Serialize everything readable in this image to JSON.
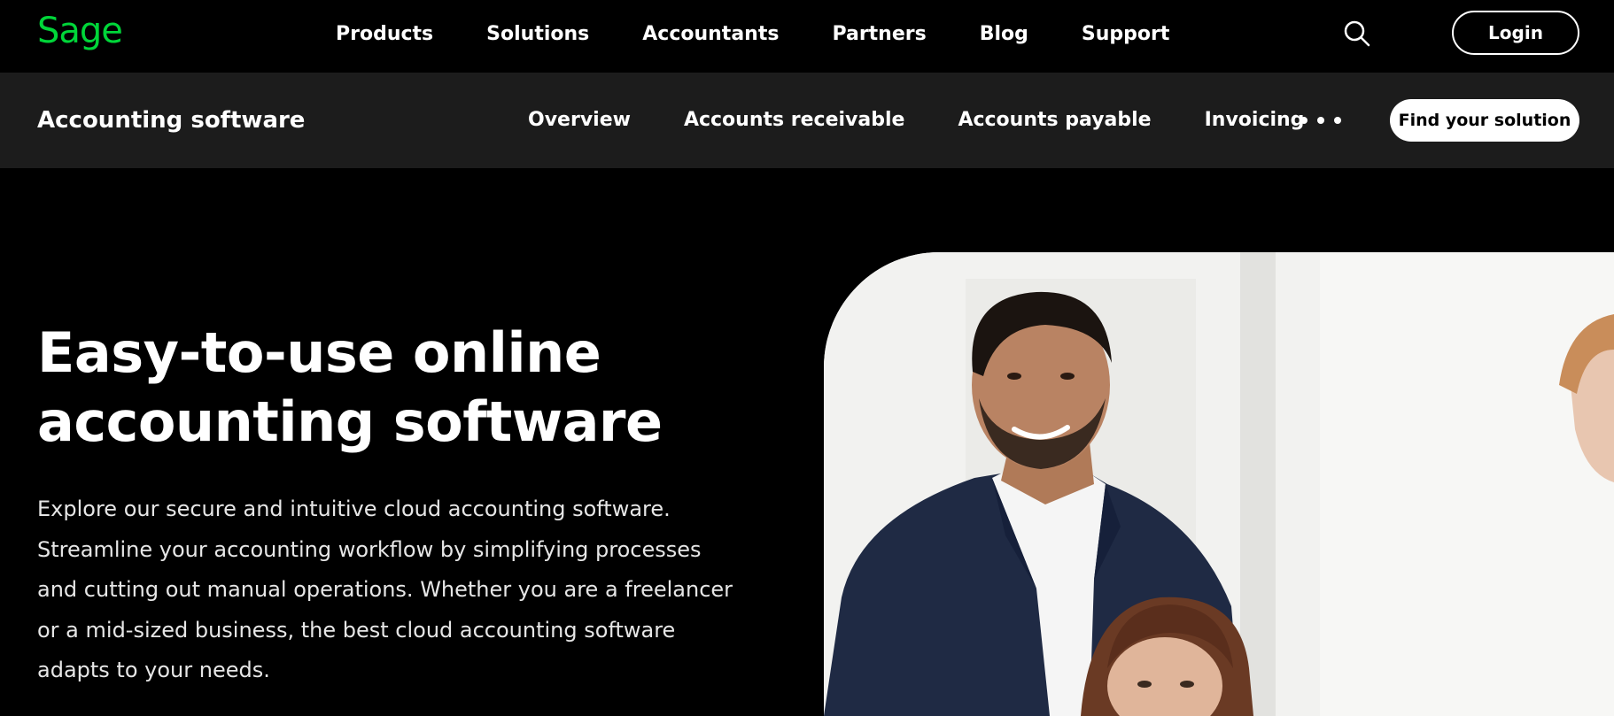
{
  "topnav": {
    "logo_text": "Sage",
    "links": [
      "Products",
      "Solutions",
      "Accountants",
      "Partners",
      "Blog",
      "Support"
    ],
    "search_icon": "search-icon",
    "login_label": "Login"
  },
  "subnav": {
    "title": "Accounting software",
    "links": [
      "Overview",
      "Accounts receivable",
      "Accounts payable",
      "Invoicing"
    ],
    "more_icon": "more-horizontal-icon",
    "cta_label": "Find your solution"
  },
  "hero": {
    "heading_line1": "Easy-to-use online",
    "heading_line2": "accounting software",
    "body": "Explore our secure and intuitive cloud accounting software. Streamline your accounting workflow by simplifying processes and cutting out manual operations. Whether you are a freelancer or a mid-sized business, the best cloud accounting software adapts to your needs.",
    "image": "office-people-photo"
  },
  "colors": {
    "background": "#000000",
    "subnav_background": "#1c1c1c",
    "brand_green": "#00d639",
    "text": "#ffffff"
  }
}
